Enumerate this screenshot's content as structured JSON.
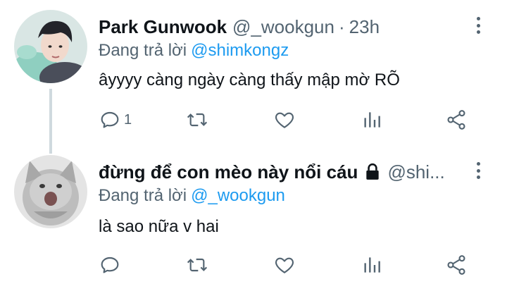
{
  "tweets": [
    {
      "display_name": "Park Gunwook",
      "handle": "@_wookgun",
      "separator": "·",
      "time": "23h",
      "reply_prefix": "Đang trả lời",
      "reply_to": "@shimkongz",
      "text": "âyyyy càng ngày càng thấy mập mờ RÕ",
      "reply_count": "1",
      "avatar_icon": "profile-photo"
    },
    {
      "display_name": "đừng để con mèo này nổi cáu",
      "handle": "@shi...",
      "reply_prefix": "Đang trả lời",
      "reply_to": "@_wookgun",
      "text": "là sao nữa v hai",
      "reply_count": "",
      "avatar_icon": "cat-photo",
      "locked": true
    }
  ],
  "colors": {
    "text": "#0f1419",
    "secondary": "#536471",
    "link": "#1d9bf0",
    "thread_line": "#cfd9de"
  }
}
